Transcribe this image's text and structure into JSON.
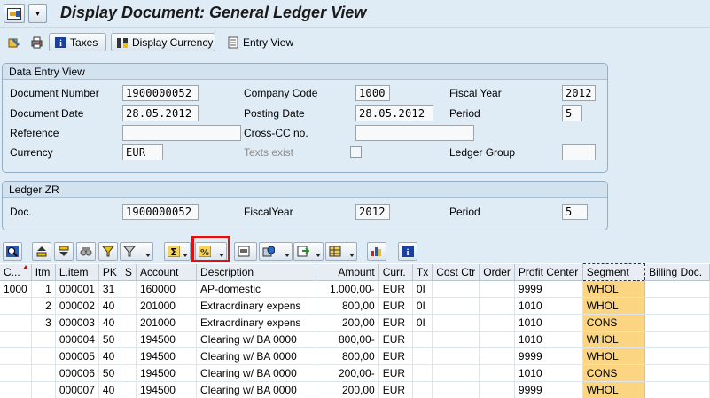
{
  "title": "Display Document: General Ledger View",
  "app_toolbar": {
    "taxes_label": "Taxes",
    "display_currency_label": "Display Currency",
    "entry_view_label": "Entry View"
  },
  "data_entry_view": {
    "header": "Data Entry View",
    "document_number_label": "Document Number",
    "document_number": "1900000052",
    "company_code_label": "Company Code",
    "company_code": "1000",
    "fiscal_year_label": "Fiscal Year",
    "fiscal_year": "2012",
    "document_date_label": "Document Date",
    "document_date": "28.05.2012",
    "posting_date_label": "Posting Date",
    "posting_date": "28.05.2012",
    "period_label": "Period",
    "period": "5",
    "reference_label": "Reference",
    "reference": "",
    "cross_cc_label": "Cross-CC no.",
    "cross_cc": "",
    "currency_label": "Currency",
    "currency": "EUR",
    "texts_exist_label": "Texts exist",
    "ledger_group_label": "Ledger Group",
    "ledger_group": ""
  },
  "ledger": {
    "header": "Ledger ZR",
    "doc_label": "Doc.",
    "doc": "1900000052",
    "fiscal_year_label": "FiscalYear",
    "fiscal_year": "2012",
    "period_label": "Period",
    "period": "5"
  },
  "grid": {
    "columns": [
      "C...",
      "Itm",
      "L.item",
      "PK",
      "S",
      "Account",
      "Description",
      "Amount",
      "Curr.",
      "Tx",
      "Cost Ctr",
      "Order",
      "Profit Center",
      "Segment",
      "Billing Doc."
    ],
    "rows": [
      [
        "1000",
        "1",
        "000001",
        "31",
        "",
        "160000",
        "AP-domestic",
        "1.000,00-",
        "EUR",
        "0I",
        "",
        "",
        "9999",
        "WHOL",
        ""
      ],
      [
        "",
        "2",
        "000002",
        "40",
        "",
        "201000",
        "Extraordinary expens",
        "800,00",
        "EUR",
        "0I",
        "",
        "",
        "1010",
        "WHOL",
        ""
      ],
      [
        "",
        "3",
        "000003",
        "40",
        "",
        "201000",
        "Extraordinary expens",
        "200,00",
        "EUR",
        "0I",
        "",
        "",
        "1010",
        "CONS",
        ""
      ],
      [
        "",
        "",
        "000004",
        "50",
        "",
        "194500",
        "Clearing w/ BA 0000",
        "800,00-",
        "EUR",
        "",
        "",
        "",
        "1010",
        "WHOL",
        ""
      ],
      [
        "",
        "",
        "000005",
        "40",
        "",
        "194500",
        "Clearing w/ BA 0000",
        "800,00",
        "EUR",
        "",
        "",
        "",
        "9999",
        "WHOL",
        ""
      ],
      [
        "",
        "",
        "000006",
        "50",
        "",
        "194500",
        "Clearing w/ BA 0000",
        "200,00-",
        "EUR",
        "",
        "",
        "",
        "1010",
        "CONS",
        ""
      ],
      [
        "",
        "",
        "000007",
        "40",
        "",
        "194500",
        "Clearing w/ BA 0000",
        "200,00",
        "EUR",
        "",
        "",
        "",
        "9999",
        "WHOL",
        ""
      ]
    ]
  },
  "colors": {
    "background": "#dfebf5",
    "segment_highlight": "#fbd581",
    "highlight_border": "#e01010"
  }
}
